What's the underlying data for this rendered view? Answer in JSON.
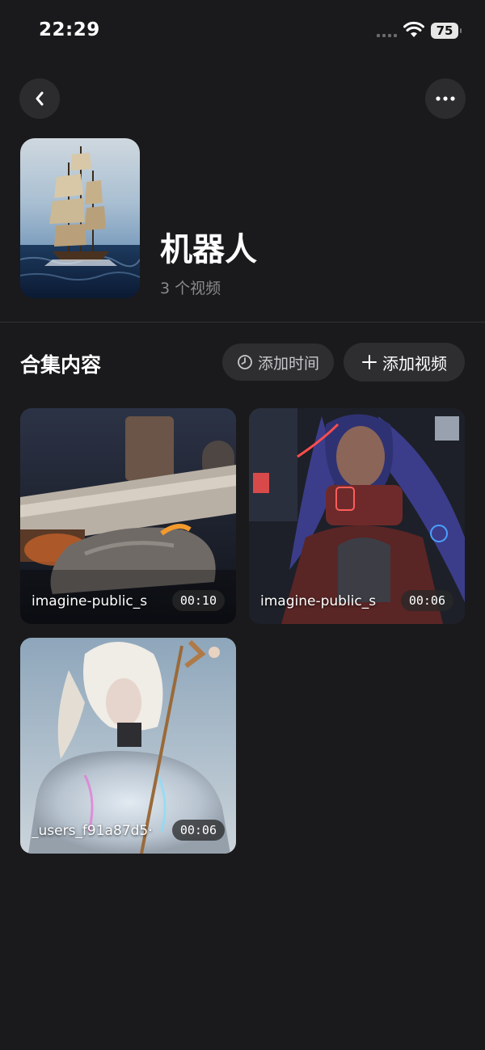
{
  "status": {
    "time": "22:29",
    "battery": "75"
  },
  "header": {
    "icons": [
      "back-arrow-icon",
      "more-dots-icon"
    ]
  },
  "collection": {
    "title": "机器人",
    "subtitle": "3 个视频"
  },
  "section": {
    "title": "合集内容",
    "add_time_label": "添加时间",
    "add_video_label": "添加视频"
  },
  "videos": [
    {
      "name": "imagine-public_s",
      "duration": "00:10"
    },
    {
      "name": "imagine-public_s",
      "duration": "00:06"
    },
    {
      "name": "_users_f91a87d5·",
      "duration": "00:06"
    }
  ],
  "colors": {
    "background": "#1a1a1c",
    "button": "#2c2c2f",
    "muted_text": "#8a8a8e"
  }
}
